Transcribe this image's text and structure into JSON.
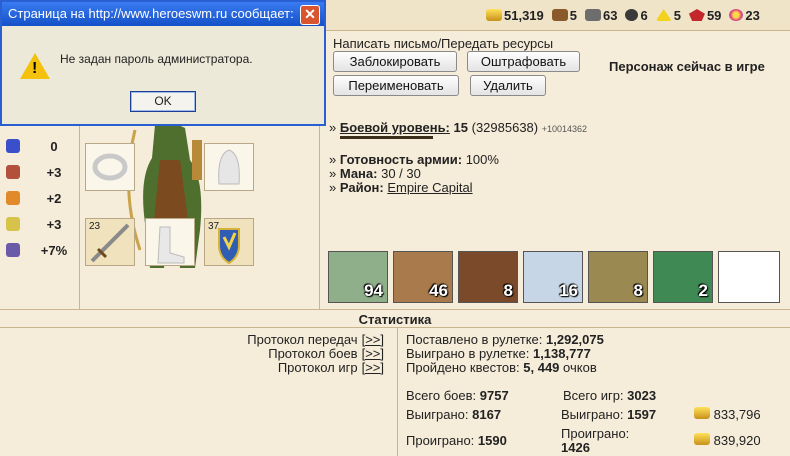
{
  "resources": [
    {
      "icon": "gold-icon",
      "cls": "gold",
      "value": "51,319"
    },
    {
      "icon": "wood-icon",
      "cls": "wood",
      "value": "5"
    },
    {
      "icon": "ore-icon",
      "cls": "ore",
      "value": "63"
    },
    {
      "icon": "mercury-icon",
      "cls": "merc",
      "value": "6"
    },
    {
      "icon": "sulfur-icon",
      "cls": "sulf",
      "value": "5"
    },
    {
      "icon": "crystal-icon",
      "cls": "crys",
      "value": "59"
    },
    {
      "icon": "gems-icon",
      "cls": "gems",
      "value": "23"
    }
  ],
  "dialog": {
    "title": "Страница на http://www.heroeswm.ru сообщает:",
    "message": "Не задан пароль администратора.",
    "ok_label": "OK",
    "close_glyph": "✕"
  },
  "actions": {
    "mail_link": "Написать письмо/Передать ресурсы",
    "block": "Заблокировать",
    "fine": "Оштрафовать",
    "rename": "Переименовать",
    "delete": "Удалить",
    "status": "Персонаж сейчас в игре"
  },
  "stats_left": [
    {
      "icon": "attack-icon",
      "value": "0"
    },
    {
      "icon": "spellbook-icon",
      "value": "+3"
    },
    {
      "icon": "rainbow-icon",
      "value": "+2"
    },
    {
      "icon": "wings-icon",
      "value": "+3"
    },
    {
      "icon": "potion-icon",
      "value": "+7%"
    }
  ],
  "equipment": {
    "sword_count": "23",
    "shield_count": "37"
  },
  "character": {
    "level_label": "Боевой уровень:",
    "level": "15",
    "exp": "(32985638)",
    "exp_delta": "+10014362",
    "army_label": "Готовность армии:",
    "army": "100%",
    "mana_label": "Мана:",
    "mana": "30 / 30",
    "district_label": "Район:",
    "district": "Empire Capital"
  },
  "army": [
    {
      "name": "elf-creature",
      "count": "94",
      "color": "#8fae8a"
    },
    {
      "name": "druid-creature",
      "count": "46",
      "color": "#a97a4c"
    },
    {
      "name": "minotaur-creature",
      "count": "8",
      "color": "#7a4a2a"
    },
    {
      "name": "unicorn-creature",
      "count": "16",
      "color": "#c7d6e6"
    },
    {
      "name": "treant-creature",
      "count": "8",
      "color": "#9a8a52"
    },
    {
      "name": "dragon-creature",
      "count": "2",
      "color": "#3f8a54"
    },
    {
      "name": "empty-slot",
      "count": "",
      "color": "#ffffff"
    }
  ],
  "statistics": {
    "title": "Статистика",
    "protocols": [
      {
        "label": "Протокол передач",
        "link": "[>>]"
      },
      {
        "label": "Протокол боев",
        "link": "[>>]"
      },
      {
        "label": "Протокол игр",
        "link": "[>>]"
      }
    ],
    "roulette_bet_label": "Поставлено в рулетке:",
    "roulette_bet": "1,292,075",
    "roulette_won_label": "Выиграно в рулетке:",
    "roulette_won": "1,138,777",
    "quests_label": "Пройдено квестов:",
    "quests": "5, 449",
    "quests_unit": "очков",
    "battles_label": "Всего боев:",
    "battles": "9757",
    "games_label": "Всего игр:",
    "games": "3023",
    "won_label": "Выиграно:",
    "won_battles": "8167",
    "won_games": "1597",
    "won_gold": "833,796",
    "lost_label": "Проиграно:",
    "lost_battles": "1590",
    "lost_games_label": "Проиграно:",
    "lost_games": "1426",
    "lost_gold": "839,920"
  }
}
